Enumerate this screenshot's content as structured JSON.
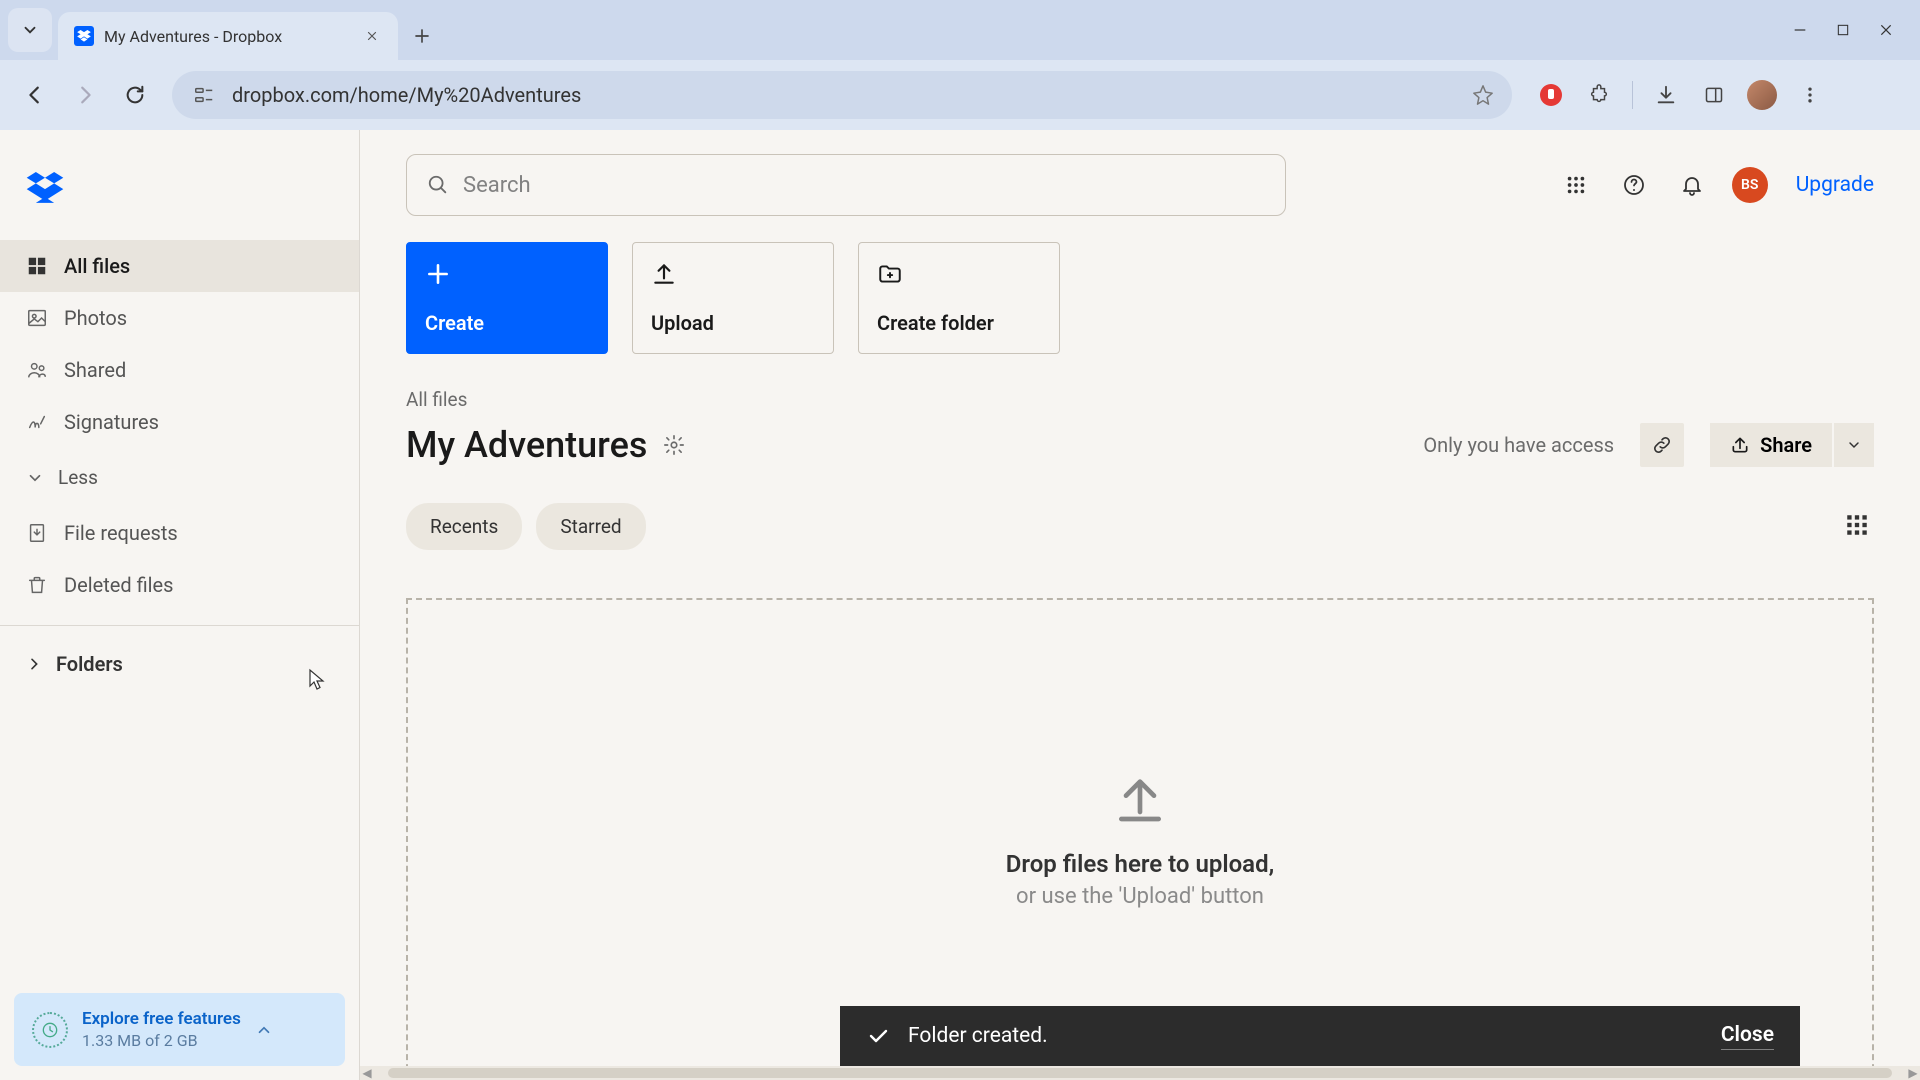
{
  "browser": {
    "tab_title": "My Adventures - Dropbox",
    "url": "dropbox.com/home/My%20Adventures"
  },
  "sidebar": {
    "items": [
      {
        "label": "All files"
      },
      {
        "label": "Photos"
      },
      {
        "label": "Shared"
      },
      {
        "label": "Signatures"
      }
    ],
    "less_label": "Less",
    "secondary": [
      {
        "label": "File requests"
      },
      {
        "label": "Deleted files"
      }
    ],
    "folders_label": "Folders",
    "promo": {
      "title": "Explore free features",
      "subtitle": "1.33 MB of 2 GB"
    }
  },
  "header": {
    "search_placeholder": "Search",
    "avatar_initials": "BS",
    "upgrade_label": "Upgrade"
  },
  "actions": {
    "create": "Create",
    "upload": "Upload",
    "create_folder": "Create folder"
  },
  "breadcrumb": "All files",
  "folder": {
    "title": "My Adventures",
    "access_text": "Only you have access",
    "share_label": "Share"
  },
  "filters": {
    "recents": "Recents",
    "starred": "Starred"
  },
  "dropzone": {
    "title": "Drop files here to upload,",
    "subtitle": "or use the 'Upload' button"
  },
  "toast": {
    "message": "Folder created.",
    "close": "Close"
  }
}
